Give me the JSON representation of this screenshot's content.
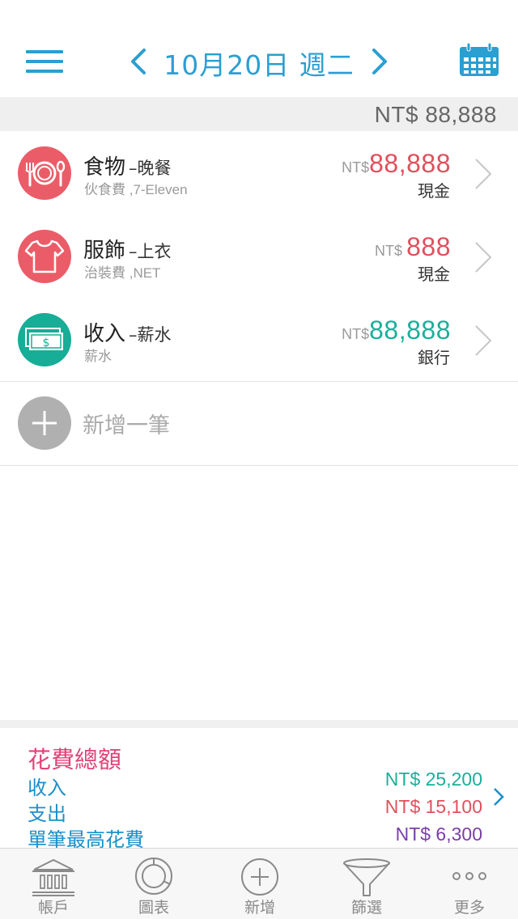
{
  "header": {
    "date_title": "10月20日 週二",
    "icons": {
      "menu": "hamburger-menu-icon",
      "prev": "chevron-left-icon",
      "next": "chevron-right-icon",
      "calendar": "calendar-icon"
    }
  },
  "total": {
    "amount": "NT$ 88,888"
  },
  "records": [
    {
      "category": "食物",
      "subcategory": "–晚餐",
      "description": "伙食費 ,7-Eleven",
      "currency": "NT$",
      "amount": "88,888",
      "account": "現金",
      "amount_color": "#e0505c",
      "circle_color": "#ea5d68",
      "icon": "fork-plate-spoon-icon"
    },
    {
      "category": "服飾",
      "subcategory": "–上衣",
      "description": "治裝費 ,NET",
      "currency": "NT$",
      "amount": "888",
      "account": "現金",
      "amount_color": "#e0505c",
      "circle_color": "#ea5d68",
      "icon": "tshirt-icon"
    },
    {
      "category": "收入",
      "subcategory": "–薪水",
      "description": "薪水",
      "currency": "NT$",
      "amount": "88,888",
      "account": "銀行",
      "amount_color": "#19b09a",
      "circle_color": "#17ad97",
      "icon": "cash-icon"
    }
  ],
  "add_record": {
    "label": "新增一筆",
    "icon": "plus-icon"
  },
  "summary": {
    "title": "花費總額",
    "income_label": "收入",
    "income_value": "NT$ 25,200",
    "expense_label": "支出",
    "expense_value": "NT$ 15,100",
    "max_label": "單筆最高花費",
    "max_value": "NT$ 6,300",
    "colors": {
      "title": "#e0447a",
      "income": "#19b09a",
      "expense": "#e0505c",
      "max": "#7a3ea8"
    }
  },
  "tabs": [
    {
      "label": "帳戶",
      "icon": "bank-icon"
    },
    {
      "label": "圖表",
      "icon": "pie-chart-icon"
    },
    {
      "label": "新增",
      "icon": "add-circle-icon"
    },
    {
      "label": "篩選",
      "icon": "filter-funnel-icon"
    },
    {
      "label": "更多",
      "icon": "more-dots-icon"
    }
  ],
  "colors": {
    "accent": "#2a9fd1"
  }
}
